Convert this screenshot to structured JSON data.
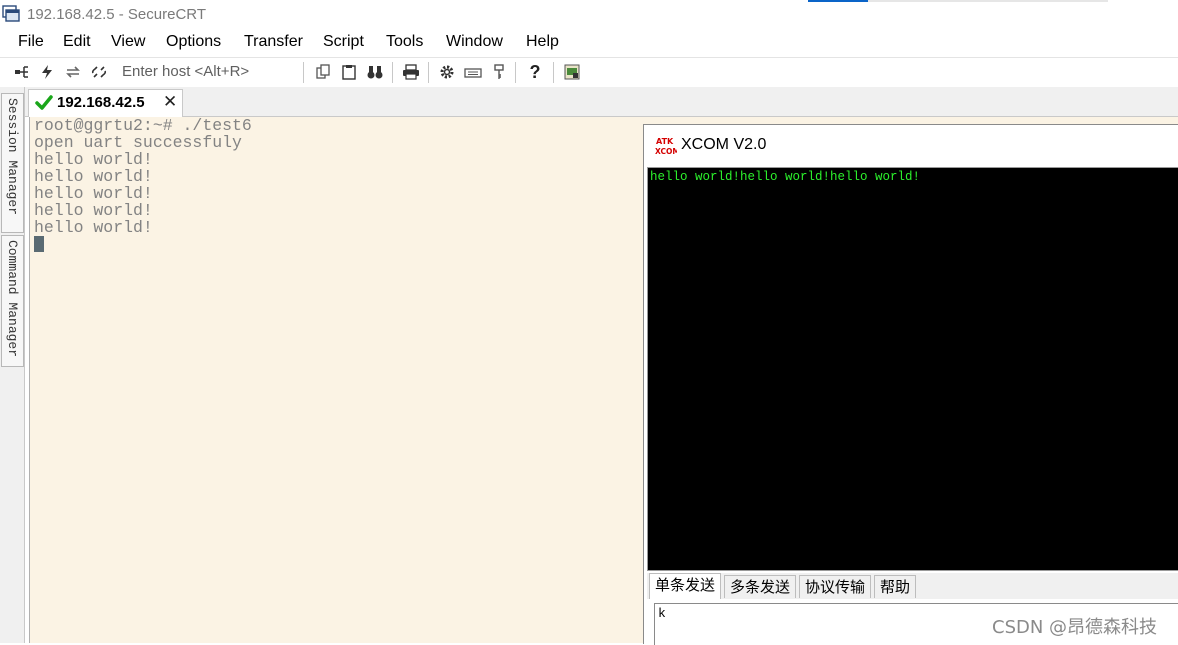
{
  "window": {
    "title": "192.168.42.5 - SecureCRT"
  },
  "menu": [
    "File",
    "Edit",
    "View",
    "Options",
    "Transfer",
    "Script",
    "Tools",
    "Window",
    "Help"
  ],
  "toolbar": {
    "host_placeholder": "Enter host <Alt+R>"
  },
  "side_panel": {
    "session_manager": "Session Manager",
    "command_manager": "Command Manager"
  },
  "session_tab": {
    "label": "192.168.42.5"
  },
  "terminal": {
    "lines": [
      "root@ggrtu2:~# ./test6",
      "open uart successfuly",
      "hello world!",
      "hello world!",
      "hello world!",
      "hello world!",
      "hello world!"
    ]
  },
  "xcom": {
    "logo": "ATK XCOM",
    "title": "XCOM V2.0",
    "receive_text": "hello world!hello world!hello world!",
    "tabs": [
      "单条发送",
      "多条发送",
      "协议传输",
      "帮助"
    ],
    "send_text": "k"
  },
  "watermark": "CSDN @昂德森科技",
  "colors": {
    "terminal_bg": "#fbf3e4",
    "terminal_text": "#838383",
    "receive_bg": "#000000",
    "receive_text": "#2cf02c",
    "check": "#1aa61a"
  }
}
